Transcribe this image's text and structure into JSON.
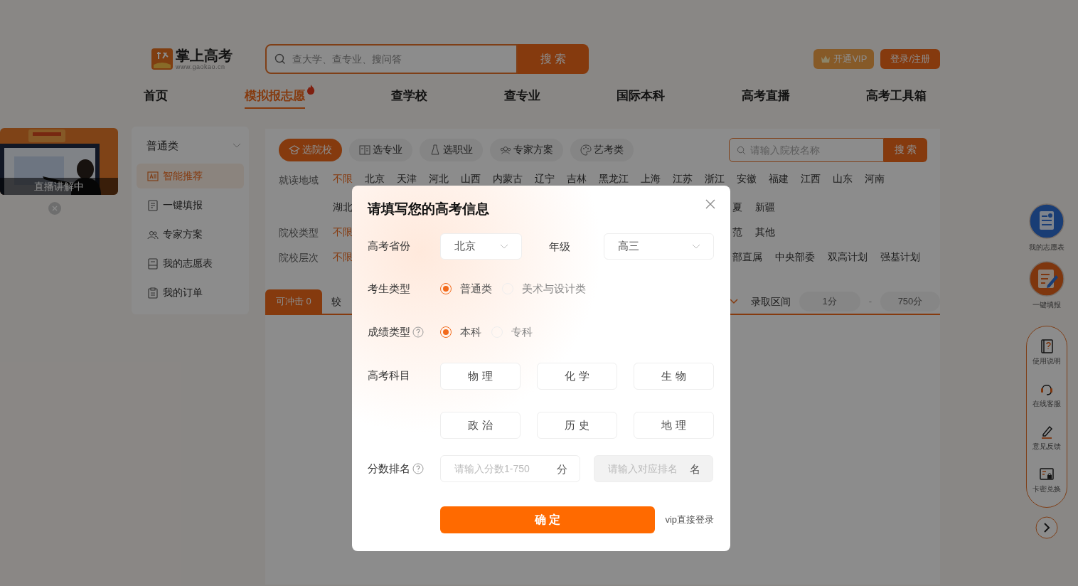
{
  "header": {
    "logo": {
      "title": "掌上高考",
      "url": "www.gaokao.cn"
    },
    "search": {
      "placeholder": "查大学、查专业、搜问答",
      "button": "搜 索"
    },
    "actions": [
      "开通VIP",
      "登录/注册"
    ]
  },
  "nav": [
    {
      "label": "首页",
      "selected": false,
      "hot": false
    },
    {
      "label": "模拟报志愿",
      "selected": true,
      "hot": true
    },
    {
      "label": "查学校",
      "selected": false,
      "hot": false
    },
    {
      "label": "查专业",
      "selected": false,
      "hot": false
    },
    {
      "label": "国际本科",
      "selected": false,
      "hot": false
    },
    {
      "label": "高考直播",
      "selected": false,
      "hot": false
    },
    {
      "label": "高考工具箱",
      "selected": false,
      "hot": false
    }
  ],
  "live_widget": {
    "caption": "直播讲解中"
  },
  "sidebar": {
    "category": "普通类",
    "items": [
      {
        "label": "智能推荐",
        "selected": true
      },
      {
        "label": "一键填报",
        "selected": false
      },
      {
        "label": "专家方案",
        "selected": false
      },
      {
        "label": "我的志愿表",
        "selected": false
      },
      {
        "label": "我的订单",
        "selected": false
      }
    ]
  },
  "main": {
    "modes": [
      {
        "label": "选院校",
        "selected": true
      },
      {
        "label": "选专业",
        "selected": false
      },
      {
        "label": "选职业",
        "selected": false
      },
      {
        "label": "专家方案",
        "selected": false
      },
      {
        "label": "艺考类",
        "selected": false
      }
    ],
    "school_search": {
      "placeholder": "请输入院校名称",
      "button": "搜 索"
    },
    "filters": [
      {
        "label": "就读地域",
        "options": [
          {
            "label": "不限",
            "selected": true
          },
          {
            "label": "北京",
            "selected": false
          },
          {
            "label": "天津",
            "selected": false
          },
          {
            "label": "河北",
            "selected": false
          },
          {
            "label": "山西",
            "selected": false
          },
          {
            "label": "内蒙古",
            "selected": false
          },
          {
            "label": "辽宁",
            "selected": false
          },
          {
            "label": "吉林",
            "selected": false
          },
          {
            "label": "黑龙江",
            "selected": false
          },
          {
            "label": "上海",
            "selected": false
          },
          {
            "label": "江苏",
            "selected": false
          },
          {
            "label": "浙江",
            "selected": false
          },
          {
            "label": "安徽",
            "selected": false
          },
          {
            "label": "福建",
            "selected": false
          },
          {
            "label": "江西",
            "selected": false
          },
          {
            "label": "山东",
            "selected": false
          },
          {
            "label": "河南",
            "selected": false
          }
        ]
      },
      {
        "options": [
          {
            "label": "湖北",
            "selected": false
          }
        ],
        "options_right": [
          {
            "label": "夏",
            "selected": false
          },
          {
            "label": "新疆",
            "selected": false
          }
        ]
      },
      {
        "label": "院校类型",
        "options": [
          {
            "label": "不限",
            "selected": true
          }
        ],
        "options_right": [
          {
            "label": "范",
            "selected": false
          },
          {
            "label": "其他",
            "selected": false
          }
        ]
      },
      {
        "label": "院校层次",
        "options": [
          {
            "label": "不限",
            "selected": true
          }
        ],
        "options_right": [
          {
            "label": "部直属",
            "selected": false
          },
          {
            "label": "中央部委",
            "selected": false
          },
          {
            "label": "双高计划",
            "selected": false
          },
          {
            "label": "强基计划",
            "selected": false
          }
        ]
      }
    ],
    "result_bar": {
      "tabs": [
        {
          "label": "可冲击 0",
          "selected": true
        },
        {
          "label": "较",
          "selected": false
        }
      ],
      "range_label": "录取区间",
      "range_min": "1分",
      "range_sep": "-",
      "range_max": "750分"
    }
  },
  "float_bar": {
    "shortcuts": [
      {
        "label": "我的志愿表",
        "kind": "list"
      },
      {
        "label": "一键填报",
        "kind": "fill"
      }
    ],
    "tools": [
      {
        "label": "使用说明",
        "kind": "help"
      },
      {
        "label": "在线客服",
        "kind": "service"
      },
      {
        "label": "意见反馈",
        "kind": "feedback"
      },
      {
        "label": "卡密兑换",
        "kind": "card"
      }
    ]
  },
  "dialog": {
    "title": "请填写您的高考信息",
    "province": {
      "label": "高考省份",
      "value": "北京"
    },
    "grade": {
      "label": "年级",
      "value": "高三"
    },
    "candidate_type": {
      "label": "考生类型",
      "options": [
        {
          "label": "普通类",
          "selected": true
        },
        {
          "label": "美术与设计类",
          "selected": false
        }
      ]
    },
    "score_type": {
      "label": "成绩类型",
      "options": [
        {
          "label": "本科",
          "selected": true
        },
        {
          "label": "专科",
          "selected": false
        }
      ]
    },
    "subjects": {
      "label": "高考科目",
      "options": [
        {
          "label": "物 理",
          "selected": false
        },
        {
          "label": "化 学",
          "selected": false
        },
        {
          "label": "生 物",
          "selected": false
        },
        {
          "label": "政 治",
          "selected": false
        },
        {
          "label": "历 史",
          "selected": false
        },
        {
          "label": "地 理",
          "selected": false
        }
      ]
    },
    "score_rank": {
      "label": "分数排名",
      "score": {
        "placeholder": "请输入分数1-750",
        "unit": "分",
        "disabled": false
      },
      "rank": {
        "placeholder": "请输入对应排名",
        "unit": "名",
        "disabled": true
      }
    },
    "confirm": "确 定",
    "vip_login": "vip直接登录"
  }
}
